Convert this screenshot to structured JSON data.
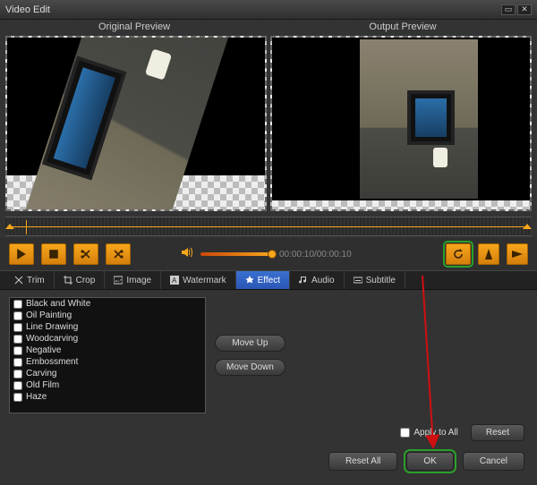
{
  "window": {
    "title": "Video Edit"
  },
  "previews": {
    "original_label": "Original Preview",
    "output_label": "Output Preview"
  },
  "controls": {
    "play": "▶",
    "stop": "■",
    "cut": "✂",
    "cut2": "✂",
    "timecode": "00:00:10/00:00:10",
    "rotate": "⟳",
    "flip_h": "▯",
    "flip_v": "◁"
  },
  "tabs": {
    "trim": "Trim",
    "crop": "Crop",
    "image": "Image",
    "watermark": "Watermark",
    "effect": "Effect",
    "audio": "Audio",
    "subtitle": "Subtitle"
  },
  "effects": {
    "items": [
      "Black and White",
      "Oil Painting",
      "Line Drawing",
      "Woodcarving",
      "Negative",
      "Embossment",
      "Carving",
      "Old Film",
      "Haze"
    ],
    "move_up": "Move Up",
    "move_down": "Move Down"
  },
  "apply": {
    "apply_all": "Apply to All",
    "reset": "Reset"
  },
  "footer": {
    "reset_all": "Reset All",
    "ok": "OK",
    "cancel": "Cancel"
  }
}
